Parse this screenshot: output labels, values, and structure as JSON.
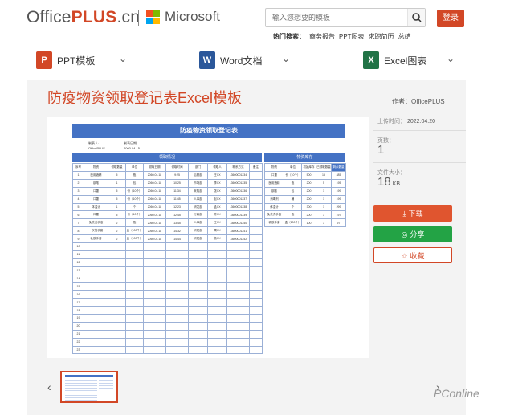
{
  "header": {
    "logo_main": "Office",
    "logo_plus": "PLUS",
    "logo_domain": ".cn",
    "ms_text": "Microsoft",
    "search_placeholder": "输入您想要的模板",
    "login": "登录",
    "hot_label": "热门搜索：",
    "hot_items": [
      "商务报告",
      "PPT图表",
      "求职简历",
      "总结"
    ]
  },
  "nav": {
    "items": [
      {
        "icon": "P",
        "label": "PPT模板",
        "color": "#d24726"
      },
      {
        "icon": "W",
        "label": "Word文档",
        "color": "#2b579a"
      },
      {
        "icon": "X",
        "label": "Excel图表",
        "color": "#217346"
      }
    ]
  },
  "doc": {
    "title": "防疫物资领取登记表Excel模板",
    "author": "作者：OfficePLUS"
  },
  "sheet": {
    "title": "防疫物资领取登记表",
    "meta1_label": "制表人:",
    "meta1_value": "OfficePLUS",
    "meta2_label": "制表日期:",
    "meta2_value": "2060.04.15",
    "left_header": "领取情况",
    "right_header": "物资库存",
    "left_cols": [
      "序号",
      "物资",
      "领取数量",
      "单位",
      "领取日期",
      "领取时间",
      "部门",
      "领取人",
      "联系方式",
      "备注"
    ],
    "left_rows": [
      [
        "1",
        "医用酒精",
        "5",
        "瓶",
        "2060.04.18",
        "9:25",
        "后勤部",
        "王XX",
        "13600001234",
        ""
      ],
      [
        "2",
        "钢笔",
        "1",
        "包",
        "2060.04.18",
        "10:25",
        "市场部",
        "李XX",
        "13600001235",
        ""
      ],
      [
        "3",
        "口罩",
        "5",
        "份（10个）",
        "2060.04.18",
        "11:34",
        "采购部",
        "张XX",
        "13600001236",
        ""
      ],
      [
        "4",
        "口罩",
        "5",
        "份（10个）",
        "2060.04.18",
        "11:45",
        "人事部",
        "赵XX",
        "13600001237",
        ""
      ],
      [
        "5",
        "体温计",
        "1",
        "个",
        "2060.04.18",
        "12:23",
        "研发部",
        "孟XX",
        "13600001238",
        ""
      ],
      [
        "6",
        "口罩",
        "5",
        "份（10个）",
        "2060.04.18",
        "12:45",
        "行政部",
        "陈XX",
        "13600001239",
        ""
      ],
      [
        "7",
        "免洗洗手液",
        "2",
        "瓶",
        "2060.04.18",
        "13:45",
        "人事部",
        "王XX",
        "13600001240",
        ""
      ],
      [
        "8",
        "一次性手套",
        "2",
        "盒（100个）",
        "2060.04.18",
        "14:32",
        "研发部",
        "周XX",
        "13600001241",
        ""
      ],
      [
        "9",
        "乳胶手套",
        "2",
        "盒（100个）",
        "2060.04.18",
        "14:44",
        "研发部",
        "杨XX",
        "13600001242",
        ""
      ],
      [
        "10",
        "",
        "",
        "",
        "",
        "",
        "",
        "",
        "",
        ""
      ],
      [
        "11",
        "",
        "",
        "",
        "",
        "",
        "",
        "",
        "",
        ""
      ],
      [
        "12",
        "",
        "",
        "",
        "",
        "",
        "",
        "",
        "",
        ""
      ],
      [
        "13",
        "",
        "",
        "",
        "",
        "",
        "",
        "",
        "",
        ""
      ],
      [
        "14",
        "",
        "",
        "",
        "",
        "",
        "",
        "",
        "",
        ""
      ],
      [
        "15",
        "",
        "",
        "",
        "",
        "",
        "",
        "",
        "",
        ""
      ],
      [
        "16",
        "",
        "",
        "",
        "",
        "",
        "",
        "",
        "",
        ""
      ],
      [
        "17",
        "",
        "",
        "",
        "",
        "",
        "",
        "",
        "",
        ""
      ],
      [
        "18",
        "",
        "",
        "",
        "",
        "",
        "",
        "",
        "",
        ""
      ],
      [
        "19",
        "",
        "",
        "",
        "",
        "",
        "",
        "",
        "",
        ""
      ],
      [
        "20",
        "",
        "",
        "",
        "",
        "",
        "",
        "",
        "",
        ""
      ],
      [
        "21",
        "",
        "",
        "",
        "",
        "",
        "",
        "",
        "",
        ""
      ],
      [
        "22",
        "",
        "",
        "",
        "",
        "",
        "",
        "",
        "",
        ""
      ],
      [
        "23",
        "",
        "",
        "",
        "",
        "",
        "",
        "",
        "",
        ""
      ]
    ],
    "right_cols": [
      "物资",
      "单位",
      "初始库存",
      "已领取数量",
      "剩余数量"
    ],
    "right_rows": [
      [
        "口罩",
        "份（10个）",
        "500",
        "15",
        "485"
      ],
      [
        "医用酒精",
        "瓶",
        "200",
        "5",
        "195"
      ],
      [
        "钢笔",
        "包",
        "200",
        "1",
        "199"
      ],
      [
        "消毒剂",
        "桶",
        "200",
        "1",
        "199"
      ],
      [
        "体温计",
        "个",
        "300",
        "1",
        "299"
      ],
      [
        "免洗洗手液",
        "瓶",
        "200",
        "3",
        "197"
      ],
      [
        "乳胶手套",
        "盒（100个）",
        "100",
        "3",
        "97"
      ]
    ]
  },
  "sidebar": {
    "upload_label": "上传时间：",
    "upload_date": "2022.04.20",
    "pages_label": "页数：",
    "pages_value": "1",
    "size_label": "文件大小：",
    "size_value": "18",
    "size_unit": "KB",
    "download": "下载",
    "share": "分享",
    "favorite": "收藏"
  },
  "colors": {
    "brand": "#d24726",
    "share": "#23a345",
    "table_blue": "#4472c4"
  },
  "watermark": "PConline"
}
